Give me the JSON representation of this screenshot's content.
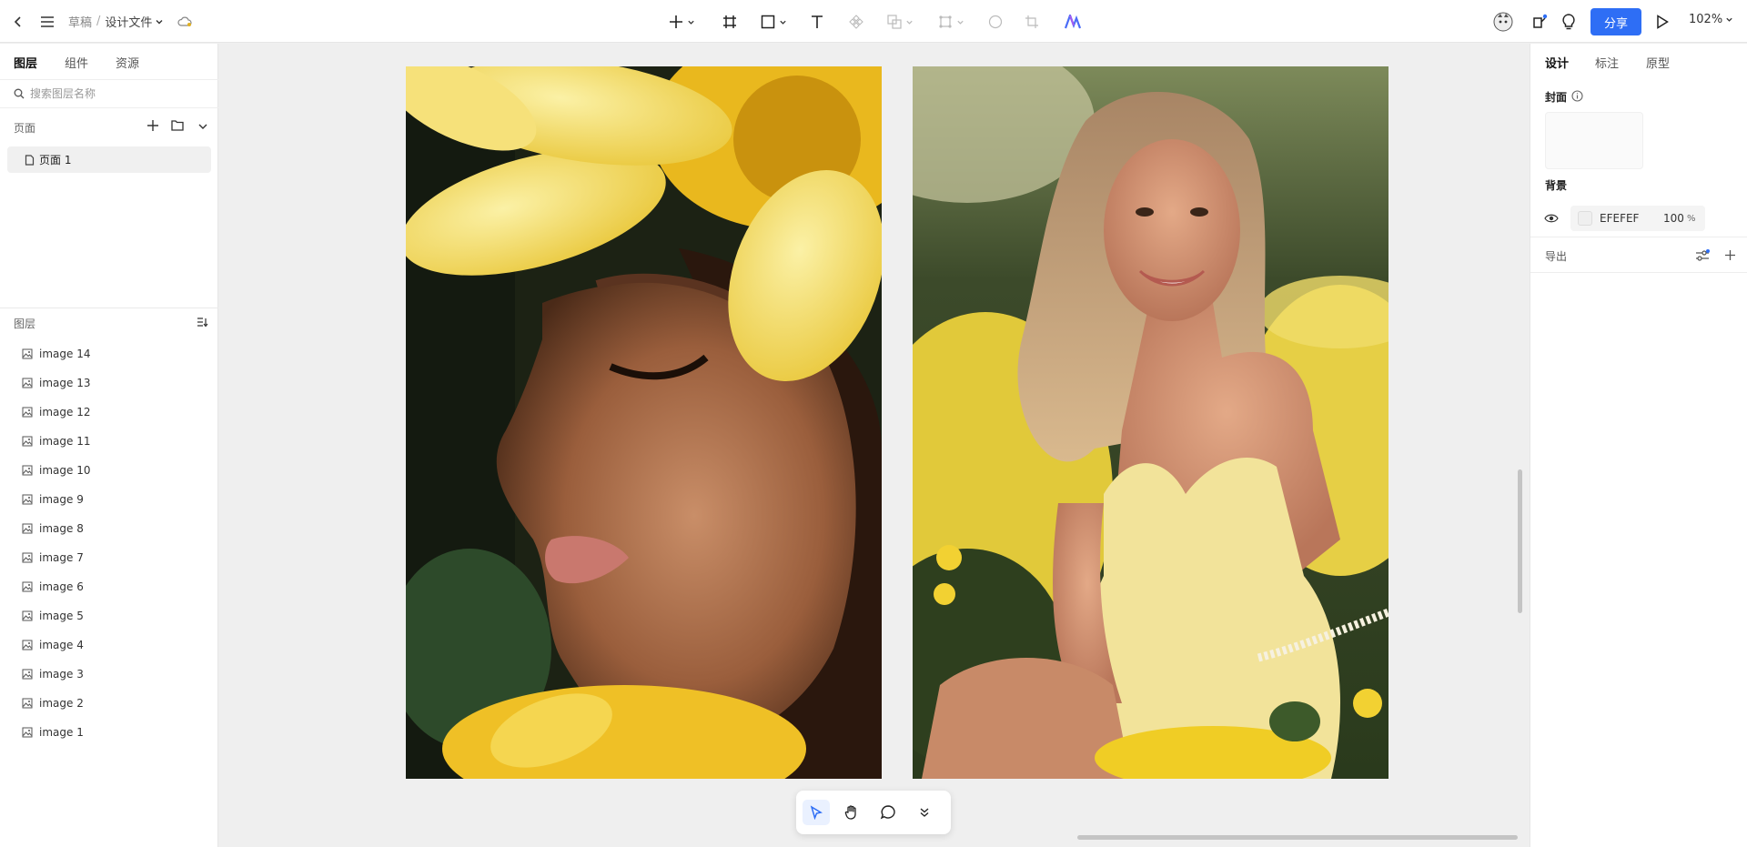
{
  "topbar": {
    "breadcrumb_root": "草稿",
    "breadcrumb_sep": "/",
    "file_name": "设计文件",
    "share_label": "分享",
    "zoom_label": "102%"
  },
  "left_panel": {
    "tabs": [
      "图层",
      "组件",
      "资源"
    ],
    "search_placeholder": "搜索图层名称",
    "pages_title": "页面",
    "page_item": "页面 1",
    "layers_title": "图层",
    "layers": [
      "image 14",
      "image 13",
      "image 12",
      "image 11",
      "image 10",
      "image 9",
      "image 8",
      "image 7",
      "image 6",
      "image 5",
      "image 4",
      "image 3",
      "image 2",
      "image 1"
    ]
  },
  "right_panel": {
    "tabs": [
      "设计",
      "标注",
      "原型"
    ],
    "cover_label": "封面",
    "background_label": "背景",
    "bg_hex": "EFEFEF",
    "bg_opacity": "100",
    "bg_unit": "%",
    "export_label": "导出"
  },
  "colors": {
    "accent": "#2e6ef5",
    "canvas_bg": "#efefef",
    "panel_bg": "#ffffff"
  },
  "canvas": {
    "images": [
      "woman-with-yellow-flower-closeup-photo",
      "smiling-woman-in-yellow-dress-photo"
    ]
  }
}
